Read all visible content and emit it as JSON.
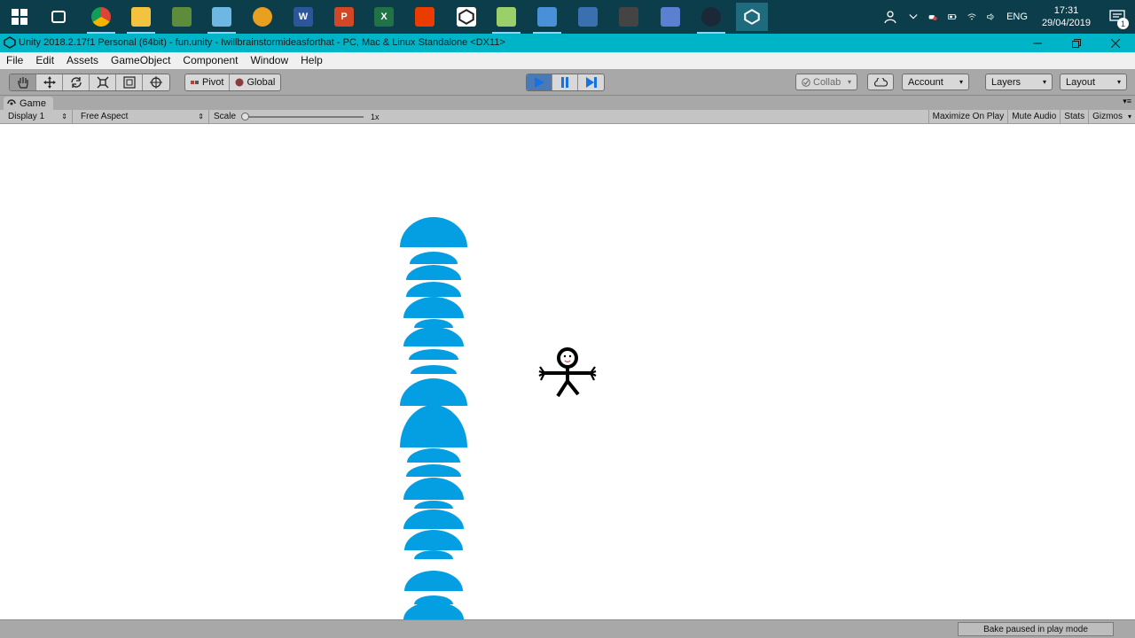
{
  "taskbar": {
    "apps": [
      {
        "name": "task-view",
        "label": "",
        "color": "#0b3d4a"
      },
      {
        "name": "chrome",
        "label": "",
        "color": "#4285f4"
      },
      {
        "name": "file-explorer",
        "label": "",
        "color": "#f3c340"
      },
      {
        "name": "minecraft",
        "label": "",
        "color": "#5d8c3b"
      },
      {
        "name": "notepad",
        "label": "",
        "color": "#6fb7e3"
      },
      {
        "name": "browser",
        "label": "",
        "color": "#e8a020"
      },
      {
        "name": "word",
        "label": "W",
        "color": "#2b579a"
      },
      {
        "name": "powerpoint",
        "label": "P",
        "color": "#d24726"
      },
      {
        "name": "excel",
        "label": "X",
        "color": "#217346"
      },
      {
        "name": "office",
        "label": "",
        "color": "#eb3c00"
      },
      {
        "name": "unity-hub",
        "label": "",
        "color": "#ffffff"
      },
      {
        "name": "app-chart",
        "label": "",
        "color": "#9bcf6a"
      },
      {
        "name": "app-desktop",
        "label": "",
        "color": "#4a90d9"
      },
      {
        "name": "app-grid",
        "label": "",
        "color": "#3a6fb0"
      },
      {
        "name": "app-game",
        "label": "",
        "color": "#444444"
      },
      {
        "name": "app-record",
        "label": "",
        "color": "#5b7fd1"
      },
      {
        "name": "steam",
        "label": "",
        "color": "#1b2838"
      },
      {
        "name": "unity",
        "label": "",
        "color": "#222222"
      }
    ],
    "tray": {
      "language": "ENG",
      "time": "17:31",
      "date": "29/04/2019",
      "notifications": "1"
    }
  },
  "title": {
    "text": "Unity 2018.2.17f1 Personal (64bit) - fun.unity - Iwillbrainstormideasforthat - PC, Mac & Linux Standalone <DX11>"
  },
  "menu": [
    "File",
    "Edit",
    "Assets",
    "GameObject",
    "Component",
    "Window",
    "Help"
  ],
  "toolbar": {
    "pivot": "Pivot",
    "global": "Global",
    "collab": "Collab",
    "account": "Account",
    "layers": "Layers",
    "layout": "Layout",
    "playing": true
  },
  "tab": {
    "label": "Game"
  },
  "gamebar": {
    "display": "Display 1",
    "aspect": "Free Aspect",
    "scale_label": "Scale",
    "scale_value": "1x",
    "maximize": "Maximize On Play",
    "mute": "Mute Audio",
    "stats": "Stats",
    "gizmos": "Gizmos"
  },
  "scene": {
    "dome_color": "#049ee3",
    "stickman_color": "#000000"
  },
  "status": {
    "bake": "Bake paused in play mode"
  }
}
